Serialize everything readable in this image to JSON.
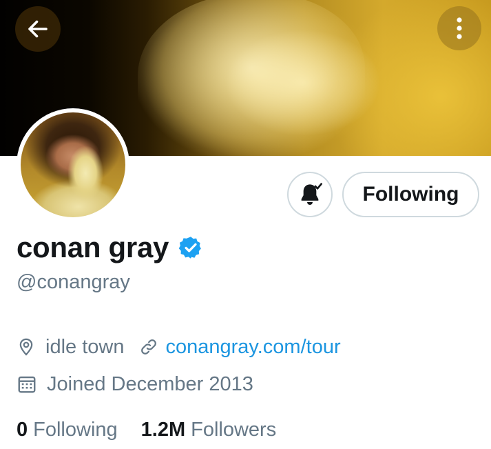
{
  "profile": {
    "name": "conan gray",
    "handle": "@conangray",
    "verified": true,
    "location": "idle town",
    "website": "conangray.com/tour",
    "joined": "Joined December 2013"
  },
  "actions": {
    "following_label": "Following"
  },
  "stats": {
    "following_count": "0",
    "following_label": "Following",
    "followers_count": "1.2M",
    "followers_label": "Followers"
  },
  "icons": {
    "back": "arrow-left-icon",
    "more": "more-vertical-icon",
    "notifications": "bell-icon",
    "verified": "verified-badge-icon",
    "location": "location-pin-icon",
    "link": "link-icon",
    "calendar": "calendar-icon"
  },
  "colors": {
    "link": "#1b95e0",
    "verified": "#1da1f2",
    "secondary_text": "#657786",
    "primary_text": "#14171a",
    "button_border": "#cfd9de"
  }
}
